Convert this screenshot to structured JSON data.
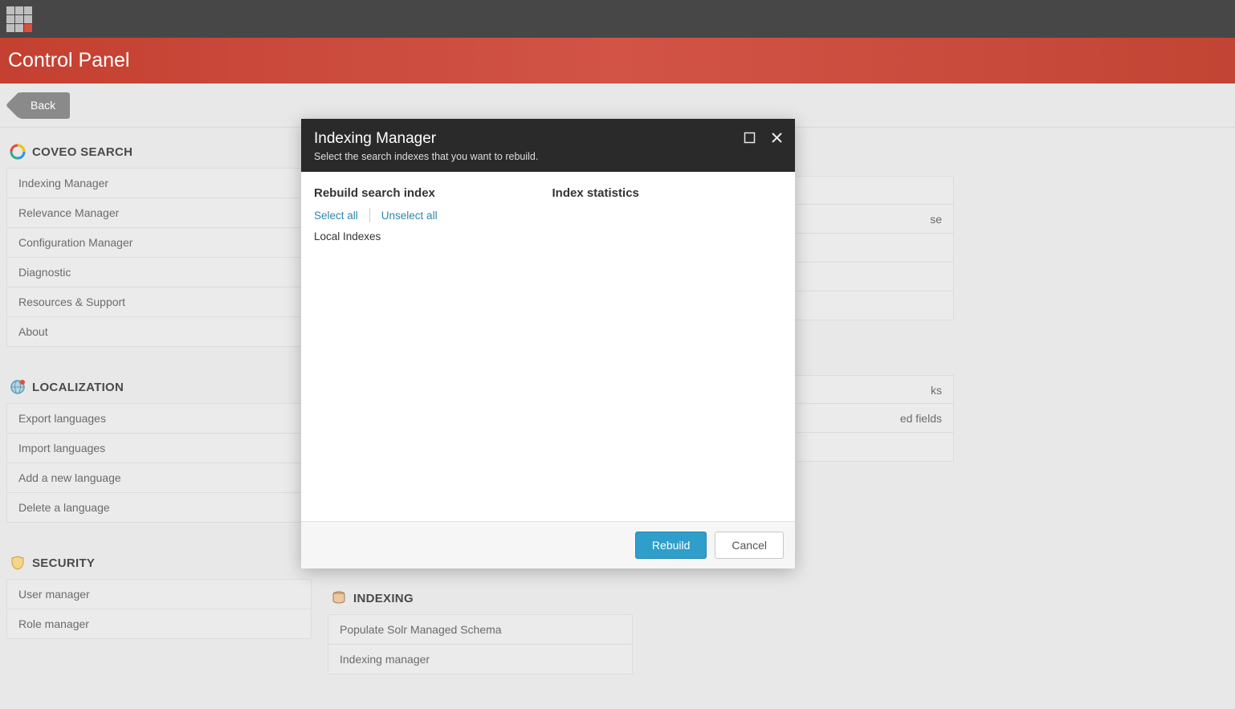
{
  "app": {
    "title": "Control Panel"
  },
  "toolbar": {
    "back_label": "Back"
  },
  "sections": {
    "coveo": {
      "title": "COVEO SEARCH",
      "items": [
        "Indexing Manager",
        "Relevance Manager",
        "Configuration Manager",
        "Diagnostic",
        "Resources & Support",
        "About"
      ]
    },
    "localization": {
      "title": "LOCALIZATION",
      "items": [
        "Export languages",
        "Import languages",
        "Add a new language",
        "Delete a language"
      ]
    },
    "security": {
      "title": "SECURITY",
      "items": [
        "User manager",
        "Role manager"
      ]
    },
    "indexing": {
      "title": "INDEXING",
      "items": [
        "Populate Solr Managed Schema",
        "Indexing manager"
      ]
    },
    "col3_visible": {
      "item0_tail": "se",
      "item1_tail": "ks",
      "item2_tail": "ed fields"
    }
  },
  "modal": {
    "title": "Indexing Manager",
    "subtitle": "Select the search indexes that you want to rebuild.",
    "left_title": "Rebuild search index",
    "right_title": "Index statistics",
    "select_all": "Select all",
    "unselect_all": "Unselect all",
    "index_item": "Local Indexes",
    "rebuild": "Rebuild",
    "cancel": "Cancel"
  }
}
